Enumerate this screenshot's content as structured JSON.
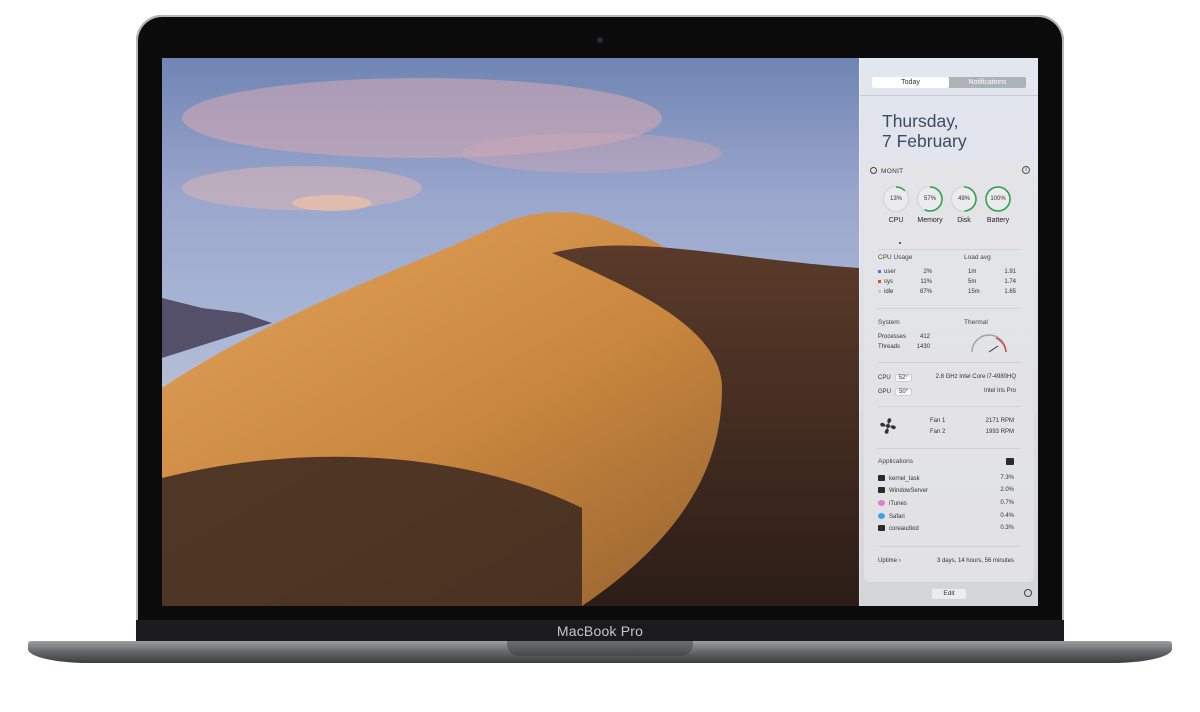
{
  "device": {
    "brand_label": "MacBook Pro"
  },
  "notification_center": {
    "tabs": [
      {
        "label": "Today",
        "active": true
      },
      {
        "label": "Notifications",
        "active": false
      }
    ],
    "date_line1": "Thursday,",
    "date_line2": "7 February",
    "widget": {
      "title": "MONIT",
      "info_icon": "info-icon",
      "gauges": [
        {
          "label": "CPU",
          "value": "13%",
          "percent": 13
        },
        {
          "label": "Memory",
          "value": "57%",
          "percent": 57
        },
        {
          "label": "Disk",
          "value": "49%",
          "percent": 49
        },
        {
          "label": "Battery",
          "value": "100%",
          "percent": 100
        }
      ],
      "cpu_usage": {
        "title": "CPU Usage",
        "rows": [
          {
            "name": "user",
            "value": "2%",
            "color": "#3b7be0"
          },
          {
            "name": "sys",
            "value": "11%",
            "color": "#e04a3b"
          },
          {
            "name": "idle",
            "value": "87%",
            "color": "#c8c8c8"
          }
        ]
      },
      "load_avg": {
        "title": "Load avg",
        "rows": [
          {
            "name": "1m",
            "value": "1.91"
          },
          {
            "name": "5m",
            "value": "1.74"
          },
          {
            "name": "15m",
            "value": "1.65"
          }
        ]
      },
      "system": {
        "title": "System",
        "rows": [
          {
            "name": "Processes",
            "value": "412"
          },
          {
            "name": "Threads",
            "value": "1430"
          }
        ]
      },
      "thermal": {
        "title": "Thermal"
      },
      "sensors": [
        {
          "name": "CPU",
          "temp": "52°",
          "desc": "2.8 GHz Intel Core i7-4980HQ"
        },
        {
          "name": "GPU",
          "temp": "50°",
          "desc": "Intel Iris Pro"
        }
      ],
      "fans": [
        {
          "name": "Fan 1",
          "value": "2171 RPM"
        },
        {
          "name": "Fan 2",
          "value": "1993 RPM"
        }
      ],
      "applications": {
        "title": "Applications",
        "items": [
          {
            "name": "kernel_task",
            "value": "7.3%",
            "icon_color": "#2b2b2b"
          },
          {
            "name": "WindowServer",
            "value": "2.0%",
            "icon_color": "#2b2b2b"
          },
          {
            "name": "iTunes",
            "value": "0.7%",
            "icon_color": "#e07ad0"
          },
          {
            "name": "Safari",
            "value": "0.4%",
            "icon_color": "#3aa0e8"
          },
          {
            "name": "coreaudiod",
            "value": "0.3%",
            "icon_color": "#2b2b2b"
          }
        ]
      },
      "uptime": {
        "label": "Uptime",
        "chevron": "›",
        "value": "3 days, 14 hours, 56 minutes"
      }
    },
    "edit_label": "Edit"
  }
}
